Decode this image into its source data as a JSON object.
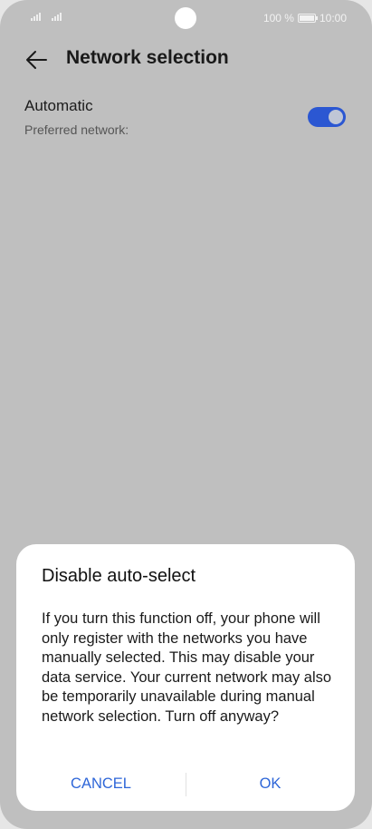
{
  "status_bar": {
    "battery_percent": "100 %",
    "time": "10:00"
  },
  "header": {
    "title": "Network selection",
    "back_icon": "arrow-left-icon"
  },
  "settings": {
    "automatic": {
      "title": "Automatic",
      "subtitle": "Preferred network:",
      "toggle_on": true,
      "accent_color": "#2b57d2"
    }
  },
  "dialog": {
    "title": "Disable auto-select",
    "message": "If you turn this function off, your phone will only register with the networks you have manually selected. This may disable your data service. Your current network may also be temporarily unavailable during manual network selection. Turn off anyway?",
    "cancel_label": "CANCEL",
    "ok_label": "OK",
    "button_color": "#2e66d8"
  }
}
